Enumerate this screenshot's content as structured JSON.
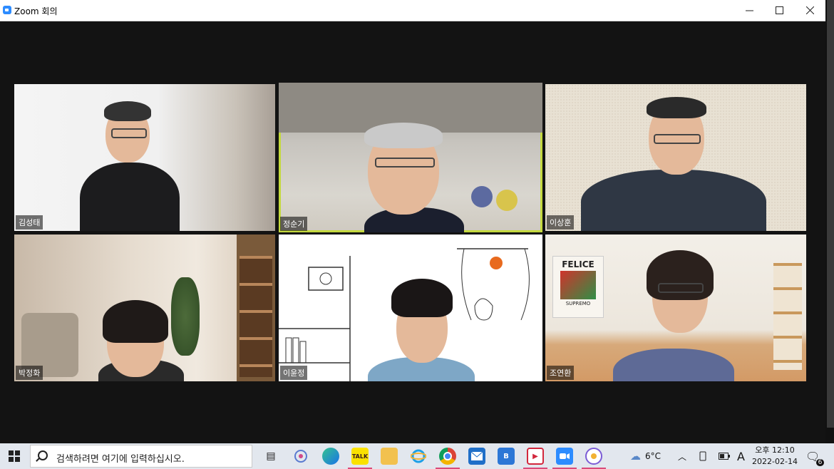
{
  "window": {
    "title": "Zoom 회의"
  },
  "participants": [
    {
      "name": "김성태"
    },
    {
      "name": "정순기",
      "active": true
    },
    {
      "name": "이상훈"
    },
    {
      "name": "박정화"
    },
    {
      "name": "이윤정"
    },
    {
      "name": "조연환"
    }
  ],
  "cafe_sign": {
    "text": "FELICE",
    "sub": "SUPREMO"
  },
  "taskbar": {
    "search_placeholder": "검색하려면 여기에 입력하십시오.",
    "apps": [
      {
        "name": "task-view"
      },
      {
        "name": "snip"
      },
      {
        "name": "edge"
      },
      {
        "name": "kakaotalk",
        "label": "TALK"
      },
      {
        "name": "file-explorer"
      },
      {
        "name": "internet-explorer"
      },
      {
        "name": "chrome"
      },
      {
        "name": "mail"
      },
      {
        "name": "b-app"
      },
      {
        "name": "video-app"
      },
      {
        "name": "zoom"
      },
      {
        "name": "other-app"
      }
    ],
    "weather": "6°C",
    "ime": "A",
    "time": "오후 12:10",
    "date": "2022-02-14",
    "notification_count": "6"
  }
}
